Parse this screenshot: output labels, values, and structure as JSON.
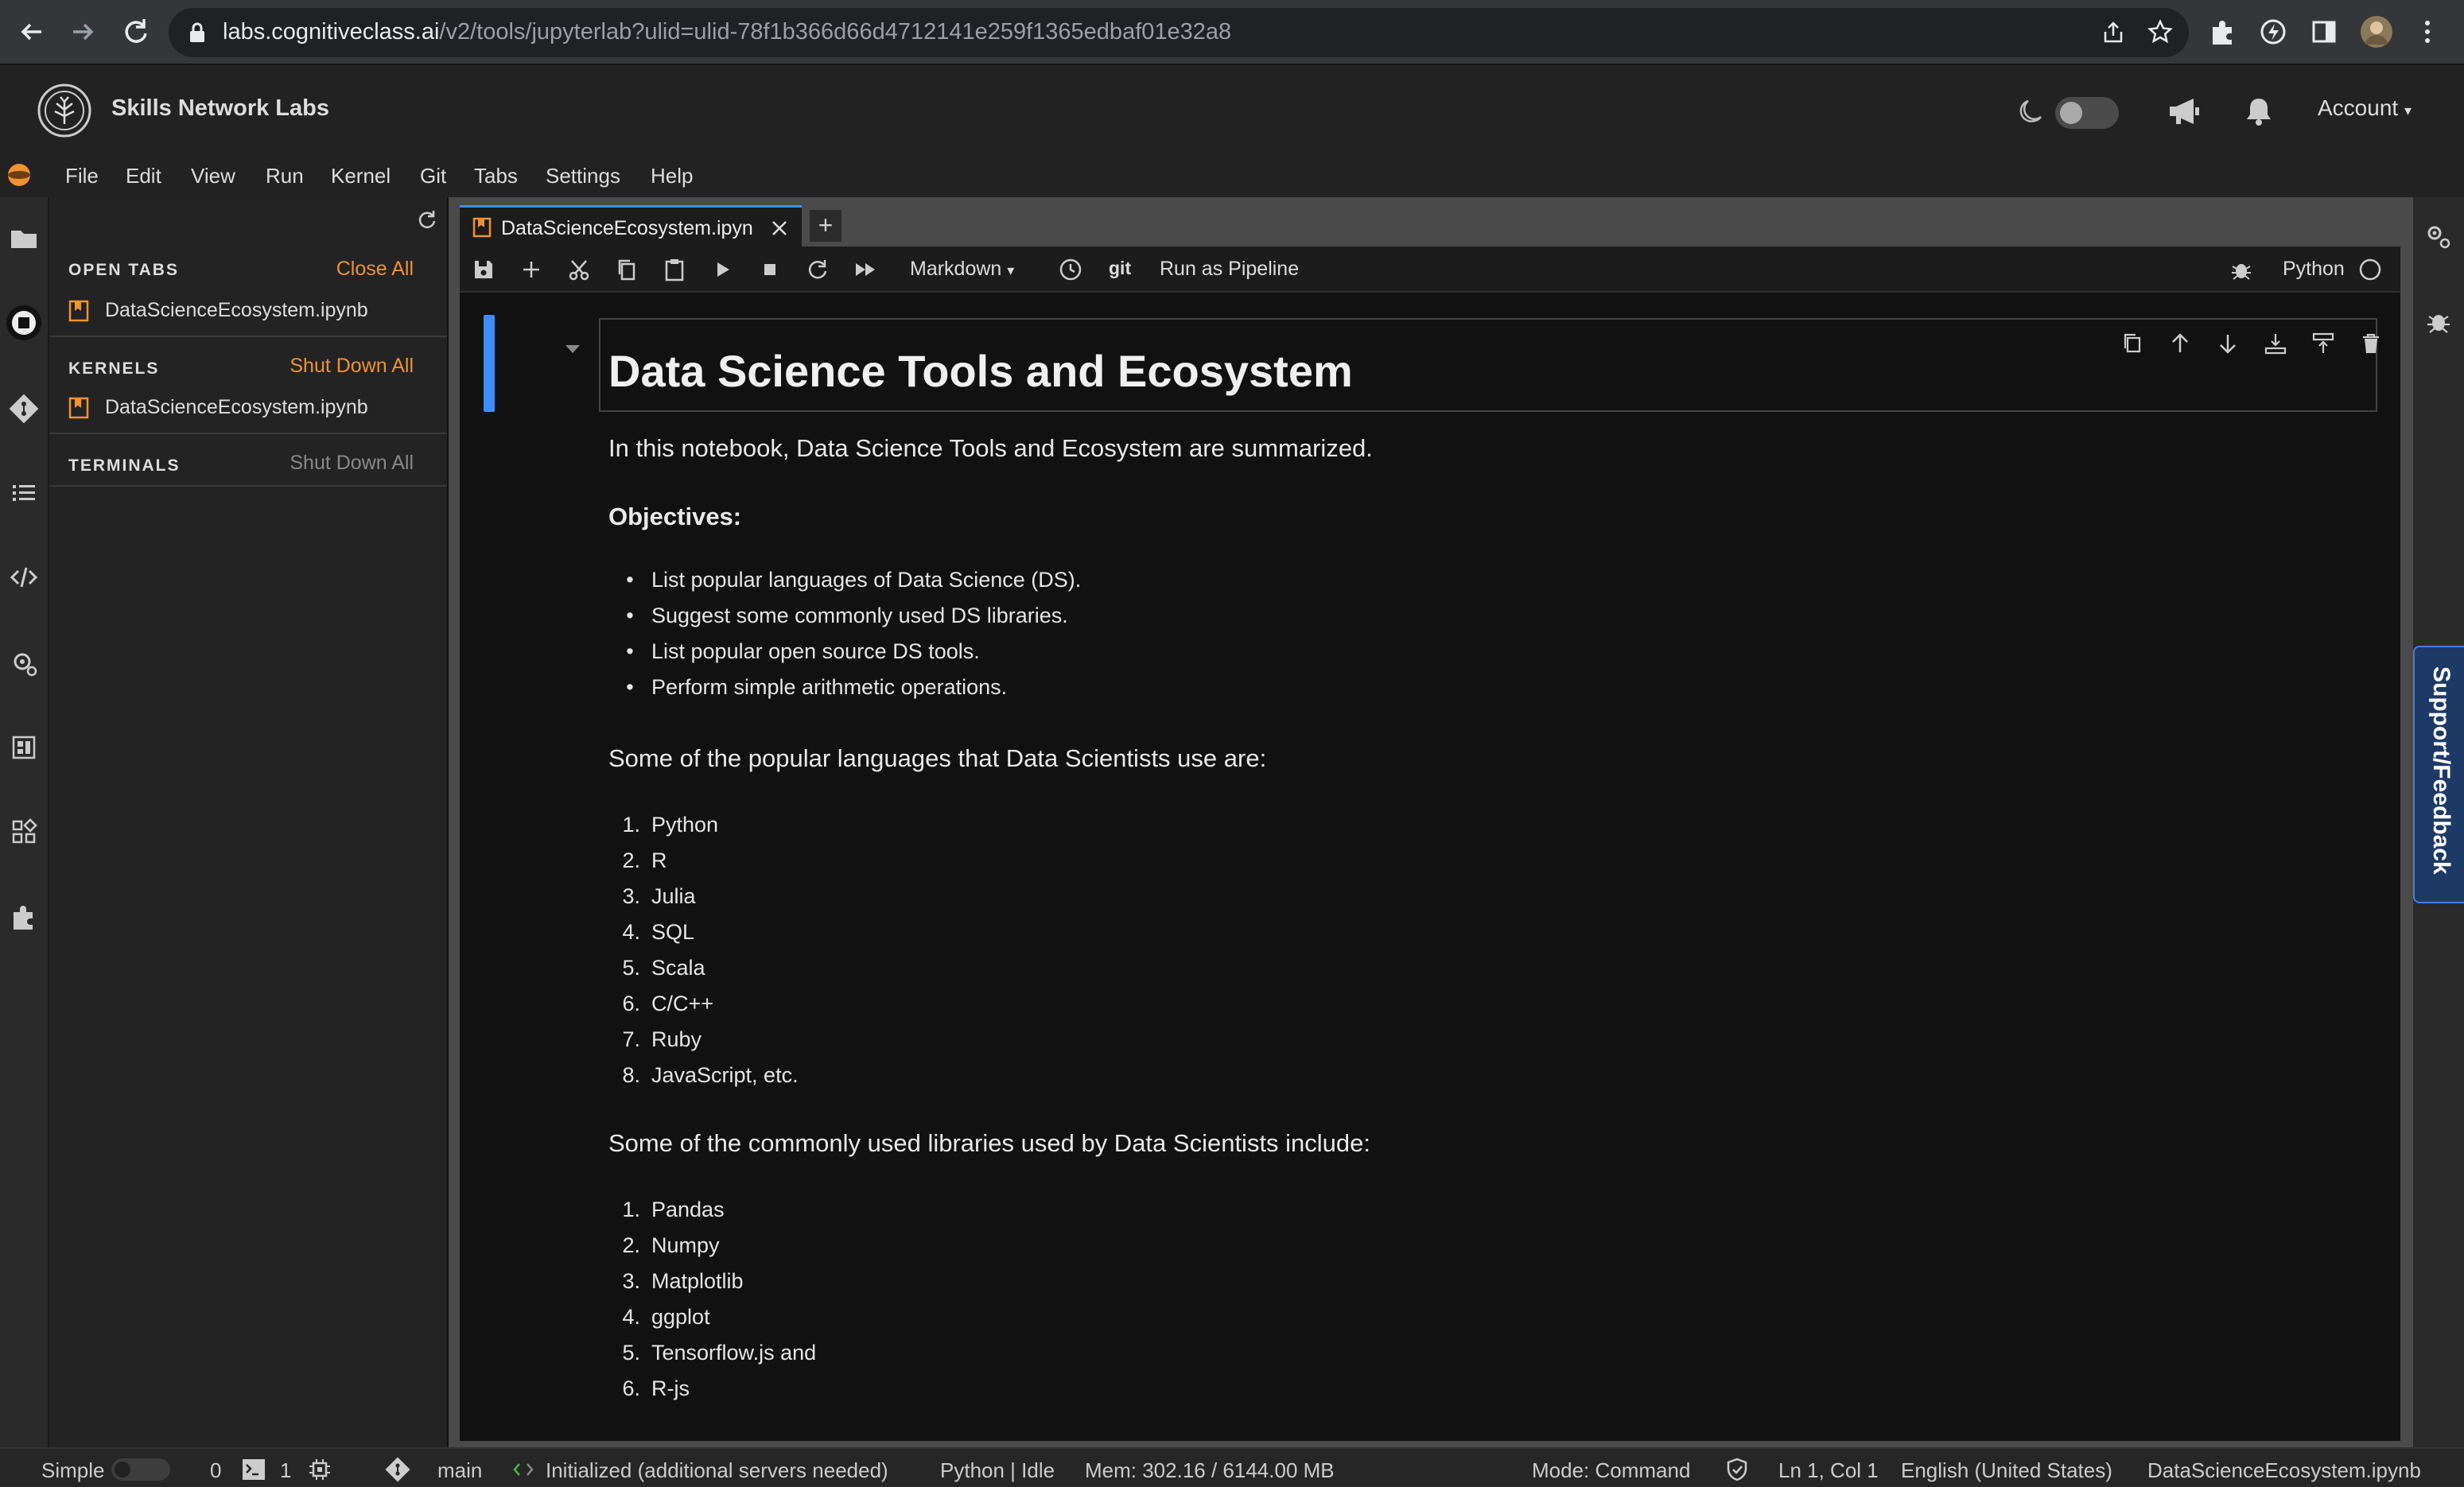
{
  "browser": {
    "url_host": "labs.cognitiveclass.ai",
    "url_path": "/v2/tools/jupyterlab?ulid=ulid-78f1b366d66d4712141e259f1365edbaf01e32a8"
  },
  "app": {
    "brand": "Skills Network Labs",
    "account": "Account"
  },
  "menubar": [
    "File",
    "Edit",
    "View",
    "Run",
    "Kernel",
    "Git",
    "Tabs",
    "Settings",
    "Help"
  ],
  "left_panel": {
    "open_tabs": {
      "title": "OPEN TABS",
      "action": "Close All",
      "items": [
        "DataScienceEcosystem.ipynb"
      ]
    },
    "kernels": {
      "title": "KERNELS",
      "action": "Shut Down All",
      "items": [
        "DataScienceEcosystem.ipynb"
      ]
    },
    "terminals": {
      "title": "TERMINALS",
      "action": "Shut Down All"
    }
  },
  "tab": {
    "label": "DataScienceEcosystem.ipyn",
    "new_tab": "+"
  },
  "toolbar": {
    "cell_type": "Markdown",
    "git": "git",
    "run_pipeline": "Run as Pipeline",
    "kernel_name": "Python"
  },
  "notebook": {
    "heading": "Data Science Tools and Ecosystem",
    "intro": "In this notebook, Data Science Tools and Ecosystem are summarized.",
    "objectives_label": "Objectives:",
    "objectives": [
      "List popular languages of Data Science (DS).",
      "Suggest some commonly used DS libraries.",
      "List popular open source DS tools.",
      "Perform simple arithmetic operations."
    ],
    "languages_intro": "Some of the popular languages that Data Scientists use are:",
    "languages": [
      "Python",
      "R",
      "Julia",
      "SQL",
      "Scala",
      "C/C++",
      "Ruby",
      "JavaScript, etc."
    ],
    "libraries_intro": "Some of the commonly used libraries used by Data Scientists include:",
    "libraries": [
      "Pandas",
      "Numpy",
      "Matplotlib",
      "ggplot",
      "Tensorflow.js and",
      "R-js"
    ]
  },
  "support": "Support/Feedback",
  "statusbar": {
    "mode_toggle": "Simple",
    "terminals": "0",
    "kernels": "1",
    "branch": "main",
    "lsp": "Initialized (additional servers needed)",
    "kernel_status": "Python | Idle",
    "memory": "Mem: 302.16 / 6144.00 MB",
    "mode": "Mode: Command",
    "position": "Ln 1, Col 1",
    "language": "English (United States)",
    "filename": "DataScienceEcosystem.ipynb"
  },
  "colors": {
    "accent": "#f0922e",
    "active": "#3f8cff",
    "support": "#1d3a66"
  }
}
